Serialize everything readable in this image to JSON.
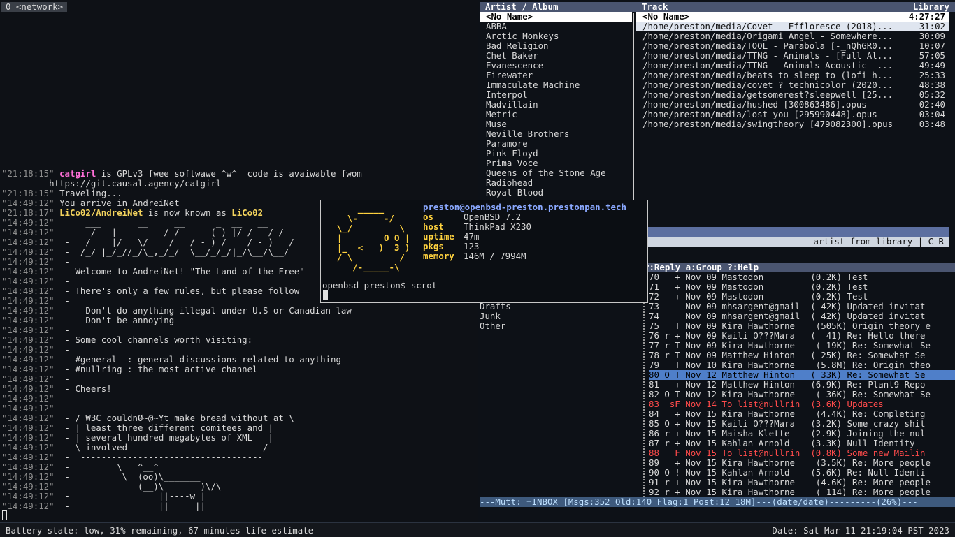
{
  "irc": {
    "tab": "0 <network>",
    "lines": [
      {
        "ts": "\"21:18:15\"",
        "parts": [
          {
            "t": "catgirl",
            "c": "pink"
          },
          {
            "t": " is GPLv3 fwee softwawe ^w^  code is avaiwable fwom"
          }
        ]
      },
      {
        "ts": "",
        "parts": [
          {
            "t": "         https://git.causal.agency/catgirl"
          }
        ]
      },
      {
        "ts": "\"21:18:15\"",
        "parts": [
          {
            "t": "Traveling..."
          }
        ]
      },
      {
        "ts": "\"14:49:12\"",
        "parts": [
          {
            "t": "You arrive in AndreiNet"
          }
        ]
      },
      {
        "ts": "\"21:18:17\"",
        "parts": [
          {
            "t": "LiCo02/AndreiNet",
            "c": "nick"
          },
          {
            "t": " is now known as "
          },
          {
            "t": "LiCo02",
            "c": "nick"
          }
        ]
      },
      {
        "ts": "\"14:49:12\"",
        "parts": [
          {
            "t": " -   ___       __     __      _  __   __"
          }
        ]
      },
      {
        "ts": "\"14:49:12\"",
        "parts": [
          {
            "t": " -    / _ | ___  ___/ /_____ (_) |/ /__ / /_"
          }
        ]
      },
      {
        "ts": "\"14:49:12\"",
        "parts": [
          {
            "t": " -   / __ |/ _ \\/ _  / __/ -_) /    / -_) __/"
          }
        ]
      },
      {
        "ts": "\"14:49:12\"",
        "parts": [
          {
            "t": " -  /_/ |_/_//_/\\_,_/_/  \\__/_/_/|_/\\__/\\__/"
          }
        ]
      },
      {
        "ts": "\"14:49:12\"",
        "parts": [
          {
            "t": " -"
          }
        ]
      },
      {
        "ts": "\"14:49:12\"",
        "parts": [
          {
            "t": " - Welcome to AndreiNet! \"The Land of the Free\""
          }
        ]
      },
      {
        "ts": "\"14:49:12\"",
        "parts": [
          {
            "t": " -"
          }
        ]
      },
      {
        "ts": "\"14:49:12\"",
        "parts": [
          {
            "t": " - There's only a few rules, but please follow"
          }
        ]
      },
      {
        "ts": "\"14:49:12\"",
        "parts": [
          {
            "t": " -"
          }
        ]
      },
      {
        "ts": "\"14:49:12\"",
        "parts": [
          {
            "t": " - - Don't do anything illegal under U.S or Canadian law"
          }
        ]
      },
      {
        "ts": "\"14:49:12\"",
        "parts": [
          {
            "t": " - - Don't be annoying"
          }
        ]
      },
      {
        "ts": "\"14:49:12\"",
        "parts": [
          {
            "t": " -"
          }
        ]
      },
      {
        "ts": "\"14:49:12\"",
        "parts": [
          {
            "t": " - Some cool channels worth visiting:"
          }
        ]
      },
      {
        "ts": "\"14:49:12\"",
        "parts": [
          {
            "t": " -"
          }
        ]
      },
      {
        "ts": "\"14:49:12\"",
        "parts": [
          {
            "t": " - #general  : general discussions related to anything"
          }
        ]
      },
      {
        "ts": "\"14:49:12\"",
        "parts": [
          {
            "t": " - #nullring : the most active channel"
          }
        ]
      },
      {
        "ts": "\"14:49:12\"",
        "parts": [
          {
            "t": " -"
          }
        ]
      },
      {
        "ts": "\"14:49:12\"",
        "parts": [
          {
            "t": " - Cheers!"
          }
        ]
      },
      {
        "ts": "\"14:49:12\"",
        "parts": [
          {
            "t": " -"
          }
        ]
      },
      {
        "ts": "\"14:49:12\"",
        "parts": [
          {
            "t": " -  ___________________________________"
          }
        ]
      },
      {
        "ts": "\"14:49:12\"",
        "parts": [
          {
            "t": " - / W3C couldnØ~@~Yt make bread without at \\"
          }
        ]
      },
      {
        "ts": "\"14:49:12\"",
        "parts": [
          {
            "t": " - | least three different comitees and |"
          }
        ]
      },
      {
        "ts": "\"14:49:12\"",
        "parts": [
          {
            "t": " - | several hundred megabytes of XML   |"
          }
        ]
      },
      {
        "ts": "\"14:49:12\"",
        "parts": [
          {
            "t": " - \\ involved                          /"
          }
        ]
      },
      {
        "ts": "\"14:49:12\"",
        "parts": [
          {
            "t": " -  -----------------------------------"
          }
        ]
      },
      {
        "ts": "\"14:49:12\"",
        "parts": [
          {
            "t": " -         \\   ^__^"
          }
        ]
      },
      {
        "ts": "\"14:49:12\"",
        "parts": [
          {
            "t": " -          \\  (oo)\\_______"
          }
        ]
      },
      {
        "ts": "\"14:49:12\"",
        "parts": [
          {
            "t": " -             (__)\\       )\\/\\"
          }
        ]
      },
      {
        "ts": "\"14:49:12\"",
        "parts": [
          {
            "t": " -                 ||----w |"
          }
        ]
      },
      {
        "ts": "\"14:49:12\"",
        "parts": [
          {
            "t": " -                 ||     ||"
          }
        ]
      }
    ]
  },
  "cmus": {
    "header_left": "Artist / Album",
    "header_mid": "Track",
    "header_right": "Library",
    "artists": [
      "<No Name>",
      "ABBA",
      "Arctic Monkeys",
      "Bad Religion",
      "Chet Baker",
      "Evanescence",
      "Firewater",
      "Immaculate Machine",
      "Interpol",
      "Madvillain",
      "Metric",
      "Muse",
      "Neville Brothers",
      "Paramore",
      "Pink Floyd",
      "Prima Voce",
      "Queens of the Stone Age",
      "Radiohead",
      "Royal Blood"
    ],
    "tracks": [
      {
        "name": "<No Name>",
        "time": "4:27:27"
      },
      {
        "name": "/home/preston/media/Covet - Effloresce (2018)...",
        "time": "31:02"
      },
      {
        "name": "/home/preston/media/Origami Angel - Somewhere...",
        "time": "30:09"
      },
      {
        "name": "/home/preston/media/TOOL - Parabola [-_nQhGR0...",
        "time": "10:07"
      },
      {
        "name": "/home/preston/media/TTNG - Animals - [Full Al...",
        "time": "57:05"
      },
      {
        "name": "/home/preston/media/TTNG - Animals Acoustic -...",
        "time": "49:49"
      },
      {
        "name": "/home/preston/media/beats to sleep to (lofi h...",
        "time": "25:33"
      },
      {
        "name": "/home/preston/media/covet ? technicolor (2020...",
        "time": "48:38"
      },
      {
        "name": "/home/preston/media/getsomerest?sleepwell [25...",
        "time": "05:32"
      },
      {
        "name": "/home/preston/media/hushed [300863486].opus",
        "time": "02:40"
      },
      {
        "name": "/home/preston/media/lost you [295990448].opus",
        "time": "03:04"
      },
      {
        "name": "/home/preston/media/swingtheory [479082300].opus",
        "time": "03:48"
      }
    ],
    "status": "artist from library | C R "
  },
  "mutt": {
    "help": "r:Reply  a:Group  ?:Help",
    "folders": [
      "Drafts",
      "Junk",
      "Other"
    ],
    "messages": [
      {
        "n": "70",
        "f": "  +",
        "d": "Nov 09",
        "from": "Mastodon        ",
        "size": "(0.2K)",
        "subj": "Test"
      },
      {
        "n": "71",
        "f": "  +",
        "d": "Nov 09",
        "from": "Mastodon        ",
        "size": "(0.2K)",
        "subj": "Test"
      },
      {
        "n": "72",
        "f": "  +",
        "d": "Nov 09",
        "from": "Mastodon        ",
        "size": "(0.2K)",
        "subj": "Test"
      },
      {
        "n": "73",
        "f": "   ",
        "d": "Nov 09",
        "from": "mhsargent@gmail ",
        "size": "( 42K)",
        "subj": "Updated invitat"
      },
      {
        "n": "74",
        "f": "   ",
        "d": "Nov 09",
        "from": "mhsargent@gmail ",
        "size": "( 42K)",
        "subj": "Updated invitat"
      },
      {
        "n": "75",
        "f": "  T",
        "d": "Nov 09",
        "from": "Kira Hawthorne   ",
        "size": "(505K)",
        "subj": "Origin theory e"
      },
      {
        "n": "76",
        "f": "r +",
        "d": "Nov 09",
        "from": "Kaili O???Mara  ",
        "size": "(  41)",
        "subj": "Re: Hello there"
      },
      {
        "n": "77",
        "f": "r T",
        "d": "Nov 09",
        "from": "Kira Hawthorne   ",
        "size": "( 19K)",
        "subj": "Re: Somewhat Se"
      },
      {
        "n": "78",
        "f": "r T",
        "d": "Nov 09",
        "from": "Matthew Hinton  ",
        "size": "( 25K)",
        "subj": "Re: Somewhat Se"
      },
      {
        "n": "79",
        "f": "  T",
        "d": "Nov 10",
        "from": "Kira Hawthorne   ",
        "size": "(5.8M)",
        "subj": "Re: Origin theo"
      },
      {
        "n": "80",
        "f": "O T",
        "d": "Nov 12",
        "from": "Matthew Hinton  ",
        "size": "( 33K)",
        "subj": "Re: Somewhat Se",
        "sel": true
      },
      {
        "n": "81",
        "f": "  +",
        "d": "Nov 12",
        "from": "Matthew Hinton  ",
        "size": "(6.9K)",
        "subj": "Re: Plant9 Repo"
      },
      {
        "n": "82",
        "f": "O T",
        "d": "Nov 12",
        "from": "Kira Hawthorne   ",
        "size": "( 36K)",
        "subj": "Re: Somewhat Se"
      },
      {
        "n": "83",
        "f": " sF",
        "d": "Nov 14",
        "from": "To list@nullrin ",
        "size": "(3.6K)",
        "subj": "Updates",
        "red": true
      },
      {
        "n": "84",
        "f": "  +",
        "d": "Nov 15",
        "from": "Kira Hawthorne   ",
        "size": "(4.4K)",
        "subj": "Re: Completing"
      },
      {
        "n": "85",
        "f": "O +",
        "d": "Nov 15",
        "from": "Kaili O???Mara  ",
        "size": "(3.2K)",
        "subj": "Some crazy shit"
      },
      {
        "n": "86",
        "f": "r +",
        "d": "Nov 15",
        "from": "Maisha Klette   ",
        "size": "(2.9K)",
        "subj": "Joining the nul"
      },
      {
        "n": "87",
        "f": "r +",
        "d": "Nov 15",
        "from": "Kahlan Arnold   ",
        "size": "(3.3K)",
        "subj": "Null Identity"
      },
      {
        "n": "88",
        "f": "  F",
        "d": "Nov 15",
        "from": "To list@nullrin ",
        "size": "(0.8K)",
        "subj": "Some new Mailin",
        "red": true
      },
      {
        "n": "89",
        "f": "  +",
        "d": "Nov 15",
        "from": "Kira Hawthorne   ",
        "size": "(3.5K)",
        "subj": "Re: More people"
      },
      {
        "n": "90",
        "f": "O !",
        "d": "Nov 15",
        "from": "Kahlan Arnold   ",
        "size": "(5.6K)",
        "subj": "Re: Null Identi"
      },
      {
        "n": "91",
        "f": "r +",
        "d": "Nov 15",
        "from": "Kira Hawthorne   ",
        "size": "(4.6K)",
        "subj": "Re: More people"
      },
      {
        "n": "92",
        "f": "r +",
        "d": "Nov 15",
        "from": "Kira Hawthorne   ",
        "size": "( 114)",
        "subj": "Re: More people"
      }
    ],
    "status": "---Mutt: =INBOX [Msgs:352 Old:140 Flag:1 Post:12 18M]---(date/date)---------(26%)---"
  },
  "neofetch": {
    "logo": [
      "      _____",
      "    \\-     -/",
      "  \\_/         \\",
      "  |        O O |",
      "  |_  <   )  3 )",
      "  / \\         /",
      "     /-_____-\\"
    ],
    "title": "preston@openbsd-preston.prestonpan.tech",
    "fields": [
      {
        "k": "os",
        "v": "OpenBSD 7.2"
      },
      {
        "k": "host",
        "v": "ThinkPad X230"
      },
      {
        "k": "uptime",
        "v": "47m"
      },
      {
        "k": "pkgs",
        "v": "123"
      },
      {
        "k": "memory",
        "v": "146M / 7994M"
      }
    ],
    "prompt": "openbsd-preston$ scrot"
  },
  "statusbar": {
    "battery": "Battery state: low, 31% remaining, 67 minutes life estimate",
    "date": "Date: Sat Mar 11 21:19:04 PST 2023"
  }
}
